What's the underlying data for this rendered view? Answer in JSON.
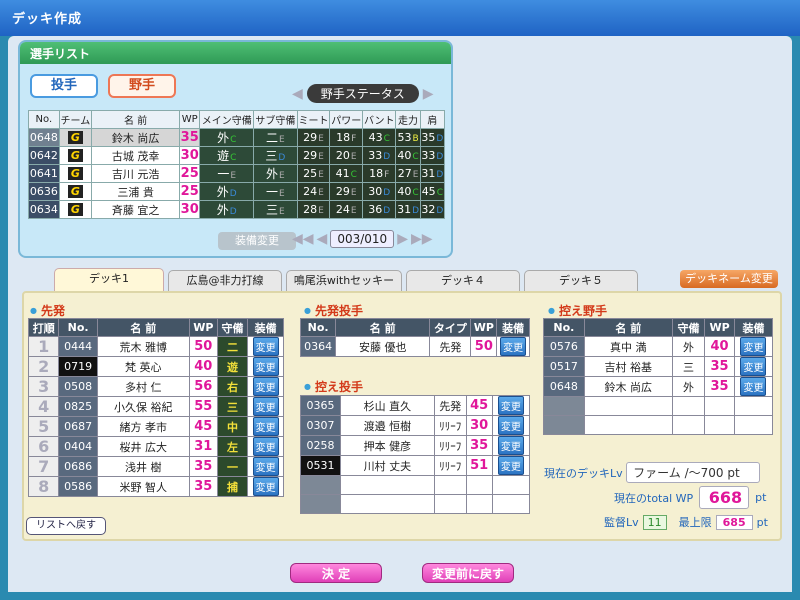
{
  "window_title": "デッキ作成",
  "player_list": {
    "title": "選手リスト",
    "btn_pitcher": "投手",
    "btn_fielder": "野手",
    "status_label": "野手ステータス",
    "headers": [
      "No.",
      "チーム",
      "名 前",
      "WP",
      "メイン守備",
      "サブ守備",
      "ミート",
      "パワー",
      "バント",
      "走力",
      "肩"
    ],
    "rows": [
      {
        "no": "0648",
        "team": "G",
        "name": "鈴木 尚広",
        "wp": "35",
        "main": "外",
        "mr": "C",
        "sub": "二",
        "sr": "E",
        "meet": "29",
        "meet_r": "E",
        "power": "18",
        "power_r": "F",
        "bunt": "43",
        "bunt_r": "C",
        "run": "53",
        "run_r": "B",
        "arm": "35",
        "arm_r": "D"
      },
      {
        "no": "0642",
        "team": "G",
        "name": "古城 茂幸",
        "wp": "30",
        "main": "遊",
        "mr": "C",
        "sub": "三",
        "sr": "D",
        "meet": "29",
        "meet_r": "E",
        "power": "20",
        "power_r": "E",
        "bunt": "33",
        "bunt_r": "D",
        "run": "40",
        "run_r": "C",
        "arm": "33",
        "arm_r": "D"
      },
      {
        "no": "0641",
        "team": "G",
        "name": "吉川 元浩",
        "wp": "25",
        "main": "一",
        "mr": "E",
        "sub": "外",
        "sr": "E",
        "meet": "25",
        "meet_r": "E",
        "power": "41",
        "power_r": "C",
        "bunt": "18",
        "bunt_r": "F",
        "run": "27",
        "run_r": "E",
        "arm": "31",
        "arm_r": "D"
      },
      {
        "no": "0636",
        "team": "G",
        "name": "三浦 貴",
        "wp": "25",
        "main": "外",
        "mr": "D",
        "sub": "一",
        "sr": "E",
        "meet": "24",
        "meet_r": "E",
        "power": "29",
        "power_r": "E",
        "bunt": "30",
        "bunt_r": "D",
        "run": "40",
        "run_r": "C",
        "arm": "45",
        "arm_r": "C"
      },
      {
        "no": "0634",
        "team": "G",
        "name": "斉藤 宜之",
        "wp": "30",
        "main": "外",
        "mr": "D",
        "sub": "三",
        "sr": "E",
        "meet": "28",
        "meet_r": "E",
        "power": "24",
        "power_r": "E",
        "bunt": "36",
        "bunt_r": "D",
        "run": "31",
        "run_r": "D",
        "arm": "32",
        "arm_r": "D"
      }
    ],
    "equip_btn": "装備変更",
    "page": "003/010"
  },
  "deck_tabs": [
    "デッキ1",
    "広島@非力打線",
    "鳴尾浜withセッキー",
    "デッキ４",
    "デッキ５"
  ],
  "rename_btn": "デッキネーム変更",
  "starters": {
    "title": "先発",
    "headers": [
      "打順",
      "No.",
      "名 前",
      "WP",
      "守備",
      "装備"
    ],
    "rows": [
      {
        "order": "1",
        "no": "0444",
        "name": "荒木 雅博",
        "wp": "50",
        "pos": "二"
      },
      {
        "order": "2",
        "no": "0719",
        "name": "梵 英心",
        "wp": "40",
        "pos": "遊"
      },
      {
        "order": "3",
        "no": "0508",
        "name": "多村 仁",
        "wp": "56",
        "pos": "右"
      },
      {
        "order": "4",
        "no": "0825",
        "name": "小久保 裕紀",
        "wp": "55",
        "pos": "三"
      },
      {
        "order": "5",
        "no": "0687",
        "name": "緒方 孝市",
        "wp": "45",
        "pos": "中"
      },
      {
        "order": "6",
        "no": "0404",
        "name": "桜井 広大",
        "wp": "31",
        "pos": "左"
      },
      {
        "order": "7",
        "no": "0686",
        "name": "浅井 樹",
        "wp": "35",
        "pos": "一"
      },
      {
        "order": "8",
        "no": "0586",
        "name": "米野 智人",
        "wp": "35",
        "pos": "捕"
      }
    ]
  },
  "change_label": "変更",
  "starting_pitcher": {
    "title": "先発投手",
    "headers": [
      "No.",
      "名 前",
      "タイプ",
      "WP",
      "装備"
    ],
    "rows": [
      {
        "no": "0364",
        "name": "安藤 優也",
        "type": "先発",
        "wp": "50"
      }
    ]
  },
  "relief_pitchers": {
    "title": "控え投手",
    "rows": [
      {
        "no": "0365",
        "name": "杉山 直久",
        "type": "先発",
        "wp": "45"
      },
      {
        "no": "0307",
        "name": "渡邉 恒樹",
        "type": "ﾘﾘｰﾌ",
        "wp": "30"
      },
      {
        "no": "0258",
        "name": "押本 健彦",
        "type": "ﾘﾘｰﾌ",
        "wp": "35"
      },
      {
        "no": "0531",
        "name": "川村 丈夫",
        "type": "ﾘﾘｰﾌ",
        "wp": "51"
      }
    ]
  },
  "bench": {
    "title": "控え野手",
    "headers": [
      "No.",
      "名 前",
      "守備",
      "WP",
      "装備"
    ],
    "rows": [
      {
        "no": "0576",
        "name": "真中 満",
        "pos": "外",
        "wp": "40"
      },
      {
        "no": "0517",
        "name": "吉村 裕基",
        "pos": "三",
        "wp": "35"
      },
      {
        "no": "0648",
        "name": "鈴木 尚広",
        "pos": "外",
        "wp": "35"
      }
    ]
  },
  "summary": {
    "deck_lv_label": "現在のデッキLv",
    "deck_lv_value": "ファーム /～700 pt",
    "total_label": "現在のtotal WP",
    "total_value": "668",
    "pt": "pt",
    "manager_label": "監督Lv",
    "manager_value": "11",
    "max_label": "最上限",
    "max_value": "685"
  },
  "back_to_list": "リストへ戻す",
  "confirm": "決 定",
  "revert": "変更前に戻す"
}
